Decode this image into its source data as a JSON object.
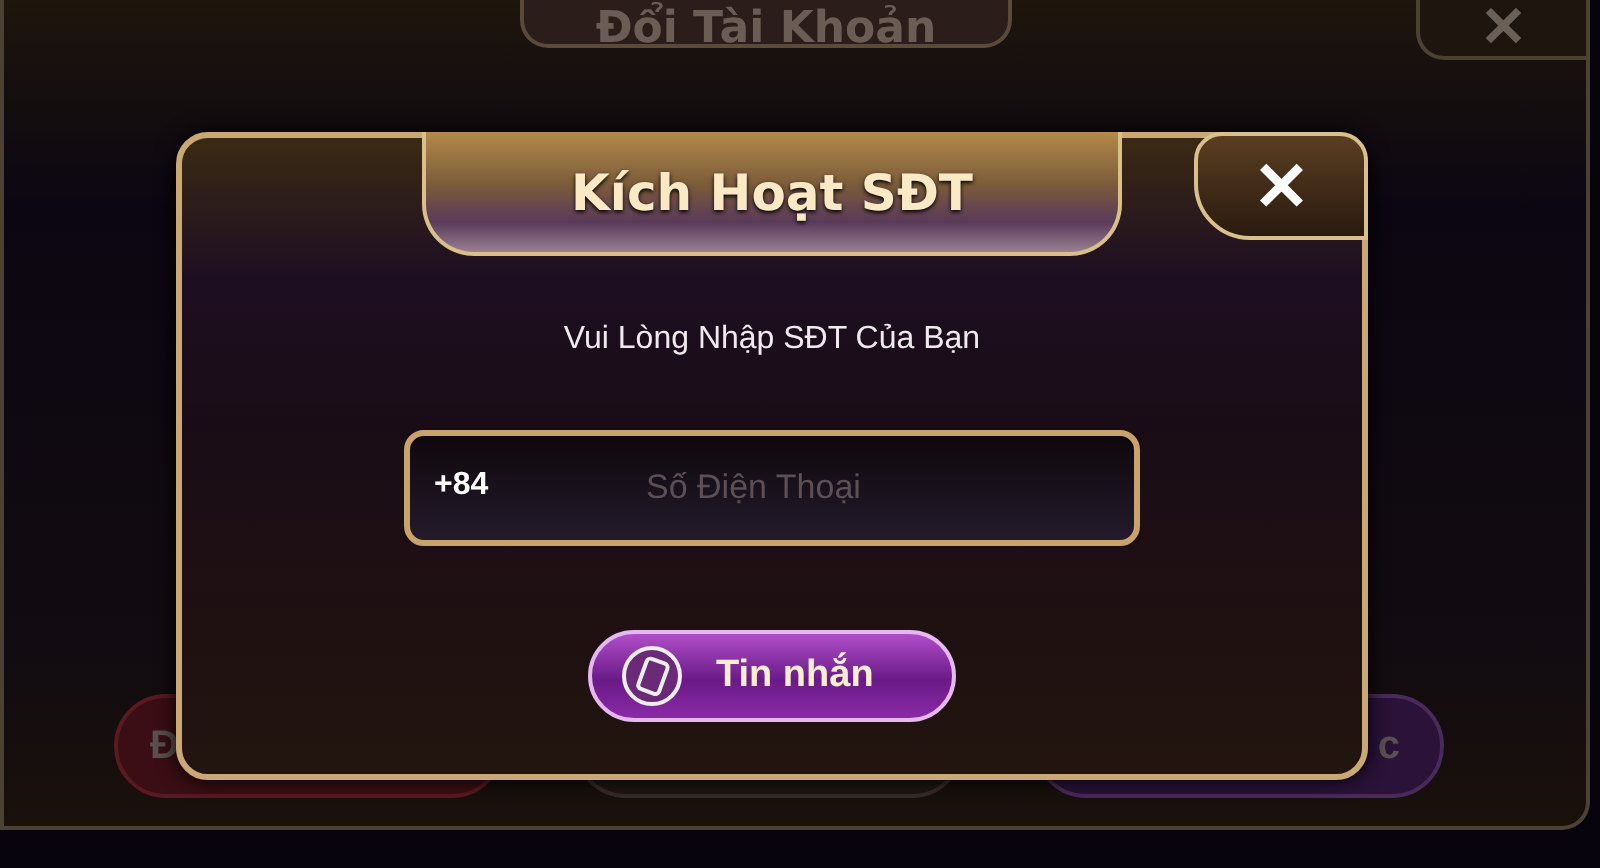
{
  "background_panel": {
    "title": "Đổi Tài Khoản",
    "close": "✕",
    "buttons": [
      {
        "label": "Đ",
        "kind": "red"
      },
      {
        "kind": "dark"
      },
      {
        "label": "c",
        "kind": "purple"
      }
    ]
  },
  "dialog": {
    "title": "Kích Hoạt SĐT",
    "close": "✕",
    "prompt": "Vui Lòng Nhập SĐT Của Bạn",
    "phone_field": {
      "prefix": "+84",
      "placeholder": "Số Điện Thoại"
    },
    "button": "Tin nhắn"
  }
}
